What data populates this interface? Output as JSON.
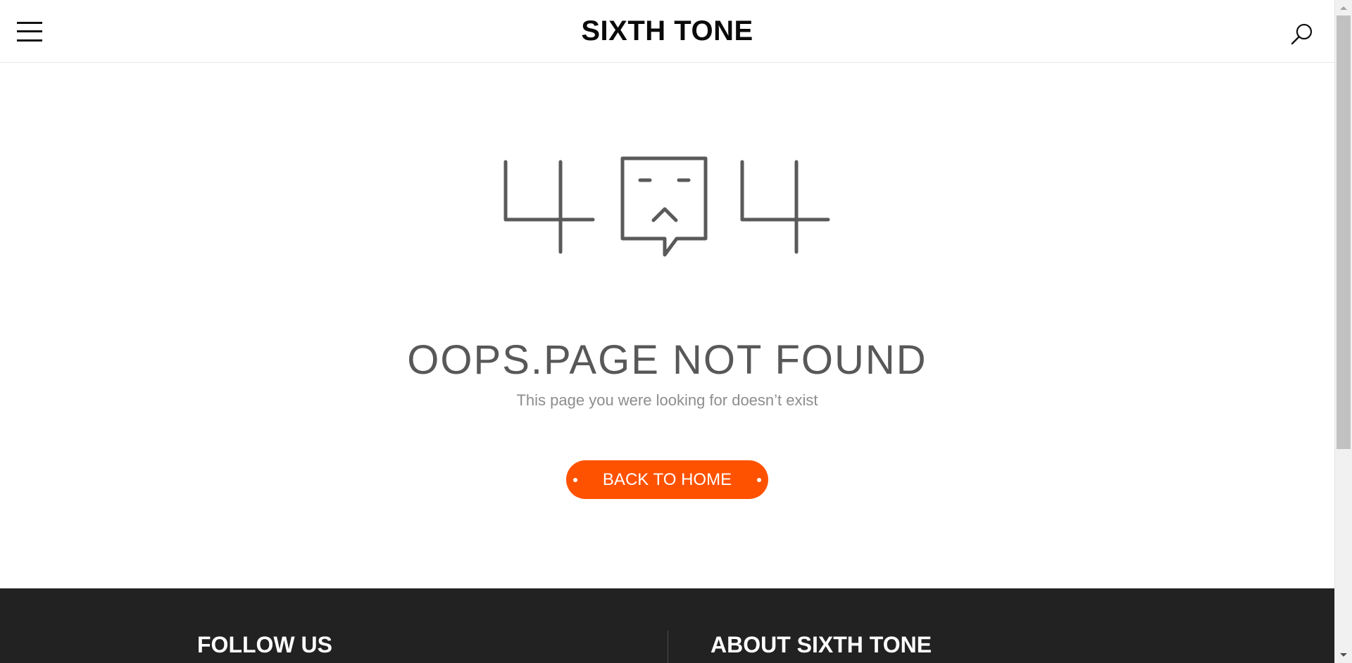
{
  "header": {
    "menu_icon": "hamburger-menu-icon",
    "logo": "SIXTH TONE",
    "search_icon": "search-icon"
  },
  "error": {
    "graphic": "404-illustration",
    "title": "OOPS.PAGE NOT FOUND",
    "subtitle": "This page you were looking for doesn’t exist",
    "home_button": "BACK TO HOME"
  },
  "footer": {
    "follow_title": "FOLLOW US",
    "about_title": "ABOUT SIXTH TONE"
  },
  "colors": {
    "accent": "#ff5200",
    "graphic": "#5a5a5a",
    "footer_bg": "#222222"
  }
}
